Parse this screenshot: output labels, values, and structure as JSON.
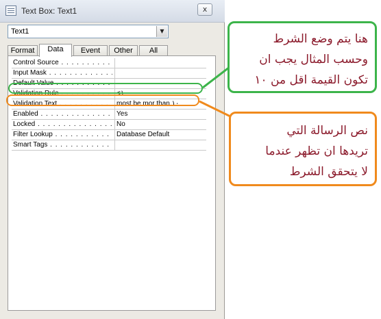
{
  "window": {
    "title": "Text Box: Text1",
    "close_label": "x",
    "object_selector_value": "Text1",
    "dropdown_arrow": "▼"
  },
  "tabs": [
    {
      "label": "Format",
      "active": false
    },
    {
      "label": "Data",
      "active": true
    },
    {
      "label": "Event",
      "active": false
    },
    {
      "label": "Other",
      "active": false
    },
    {
      "label": "All",
      "active": false
    }
  ],
  "properties": [
    {
      "label": "Control Source",
      "dots": " . . . . . . . . . . .",
      "value": ""
    },
    {
      "label": "Input Mask",
      "dots": " . . . . . . . . . . . . . .",
      "value": ""
    },
    {
      "label": "Default Value",
      "dots": " . . . . . . . . . . .",
      "value": ""
    },
    {
      "label": "Validation Rule",
      "dots": " . . . . . . . . . .",
      "value": "<١٠"
    },
    {
      "label": "Validation Text",
      "dots": " . . . . . . . . . .",
      "value": "most be mor than ١٠"
    },
    {
      "label": "Enabled",
      "dots": " . . . . . . . . . . . . . . . .",
      "value": "Yes"
    },
    {
      "label": "Locked",
      "dots": " . . . . . . . . . . . . . . . . .",
      "value": "No"
    },
    {
      "label": "Filter Lookup",
      "dots": " . . . . . . . . . . . . .",
      "value": "Database Default"
    },
    {
      "label": "Smart Tags",
      "dots": " . . . . . . . . . . . . . .",
      "value": ""
    }
  ],
  "annotations": {
    "green": {
      "lines": [
        "هنا يتم وضع الشرط",
        "وحسب المثال يجب ان",
        "تكون القيمة اقل من ١٠"
      ],
      "color": "#3cb44a"
    },
    "orange": {
      "lines": [
        "نص الرسالة التي",
        "تريدها ان تظهر عندما",
        "لا يتحقق الشرط"
      ],
      "color": "#f08a1c"
    },
    "text_color": "#8b1a2b"
  }
}
